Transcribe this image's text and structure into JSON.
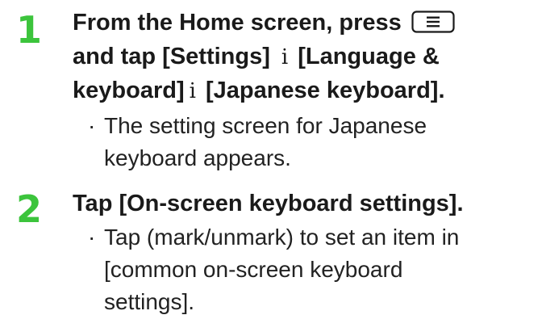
{
  "steps": [
    {
      "number": "1",
      "title": {
        "line1_text": "From the Home screen, press",
        "line2_a": "and tap [Settings]",
        "arrow": "i",
        "line2_b": "[Language &",
        "line3_a": "keyboard]",
        "line3_b": "[Japanese keyboard]."
      },
      "menu_key_icon": "menu-key-icon",
      "bullet_mark": "·",
      "bullet_line1": "The setting screen for Japanese",
      "bullet_line2": "keyboard appears."
    },
    {
      "number": "2",
      "title": "Tap [On-screen keyboard settings].",
      "bullet_mark": "·",
      "bullet_line1": "Tap (mark/unmark) to set an item in",
      "bullet_line2": "[common on-screen keyboard",
      "bullet_line3": "settings]."
    }
  ],
  "colors": {
    "step_number": "#3cc43c",
    "text": "#1a1a1a"
  }
}
